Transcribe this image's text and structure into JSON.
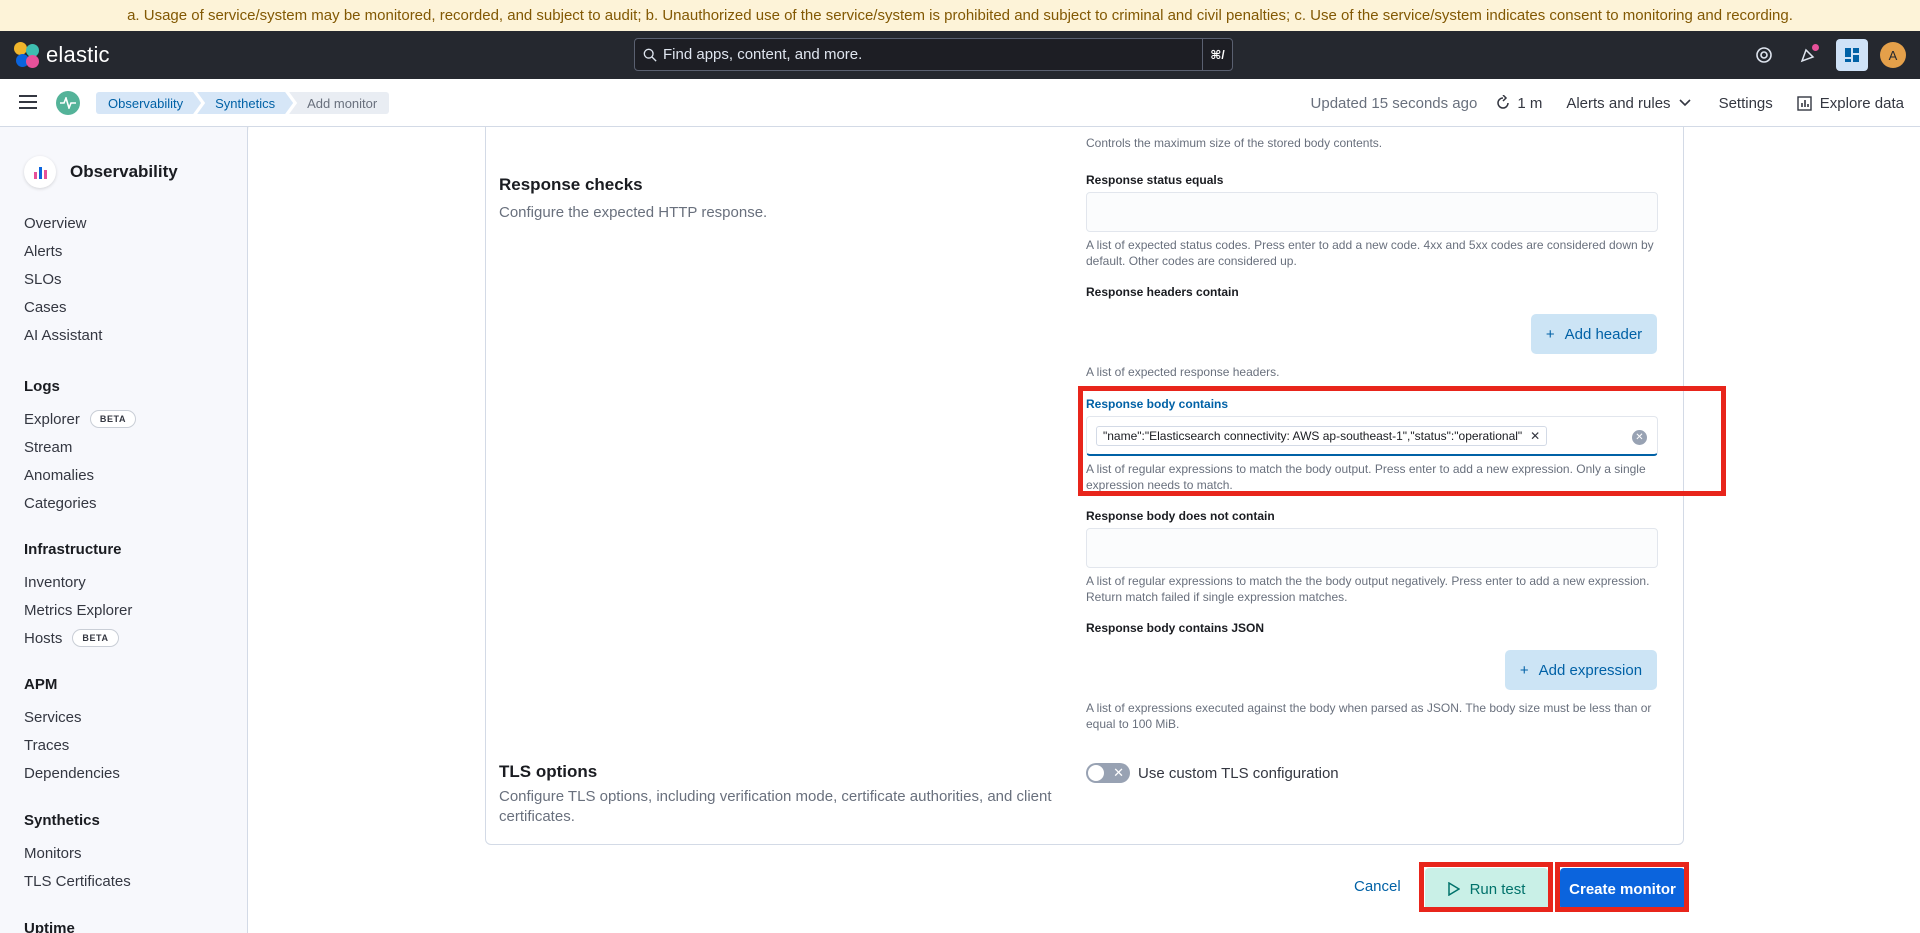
{
  "banner": {
    "text": "a. Usage of service/system may be monitored, recorded, and subject to audit; b. Unauthorized use of the service/system is prohibited and subject to criminal and civil penalties; c. Use of the service/system indicates consent to monitoring and recording."
  },
  "header": {
    "logo_text": "elastic",
    "search_placeholder": "Find apps, content, and more.",
    "search_shortcut": "⌘/",
    "avatar_initial": "A",
    "colors": {
      "top_bg": "#25282f",
      "accent": "#0b64dd"
    }
  },
  "breadcrumbs": [
    "Observability",
    "Synthetics",
    "Add monitor"
  ],
  "subbar": {
    "updated": "Updated 15 seconds ago",
    "refresh_interval": "1 m",
    "alerts_label": "Alerts and rules",
    "settings_label": "Settings",
    "explore_label": "Explore data"
  },
  "sidebar": {
    "title": "Observability",
    "top_items": [
      "Overview",
      "Alerts",
      "SLOs",
      "Cases",
      "AI Assistant"
    ],
    "groups": [
      {
        "title": "Logs",
        "items": [
          {
            "label": "Explorer",
            "badge": "BETA"
          },
          {
            "label": "Stream"
          },
          {
            "label": "Anomalies"
          },
          {
            "label": "Categories"
          }
        ]
      },
      {
        "title": "Infrastructure",
        "items": [
          {
            "label": "Inventory"
          },
          {
            "label": "Metrics Explorer"
          },
          {
            "label": "Hosts",
            "badge": "BETA"
          }
        ]
      },
      {
        "title": "APM",
        "items": [
          {
            "label": "Services"
          },
          {
            "label": "Traces"
          },
          {
            "label": "Dependencies"
          }
        ]
      },
      {
        "title": "Synthetics",
        "items": [
          {
            "label": "Monitors"
          },
          {
            "label": "TLS Certificates"
          }
        ]
      },
      {
        "title": "Uptime",
        "items": []
      }
    ]
  },
  "form": {
    "body_size_help": "Controls the maximum size of the stored body contents.",
    "response_checks": {
      "title": "Response checks",
      "description": "Configure the expected HTTP response.",
      "status_label": "Response status equals",
      "status_help": "A list of expected status codes. Press enter to add a new code. 4xx and 5xx codes are considered down by default. Other codes are considered up.",
      "headers_label": "Response headers contain",
      "add_header": "Add header",
      "headers_help": "A list of expected response headers.",
      "body_contains_label": "Response body contains",
      "body_contains_chip": "\"name\":\"Elasticsearch connectivity: AWS ap-southeast-1\",\"status\":\"operational\"",
      "body_contains_help": "A list of regular expressions to match the body output. Press enter to add a new expression. Only a single expression needs to match.",
      "body_not_contains_label": "Response body does not contain",
      "body_not_contains_help": "A list of regular expressions to match the the body output negatively. Press enter to add a new expression. Return match failed if single expression matches.",
      "body_json_label": "Response body contains JSON",
      "add_expression": "Add expression",
      "body_json_help": "A list of expressions executed against the body when parsed as JSON. The body size must be less than or equal to 100 MiB."
    },
    "tls": {
      "title": "TLS options",
      "description": "Configure TLS options, including verification mode, certificate authorities, and client certificates.",
      "toggle_label": "Use custom TLS configuration"
    }
  },
  "actions": {
    "cancel": "Cancel",
    "run_test": "Run test",
    "create_monitor": "Create monitor"
  }
}
